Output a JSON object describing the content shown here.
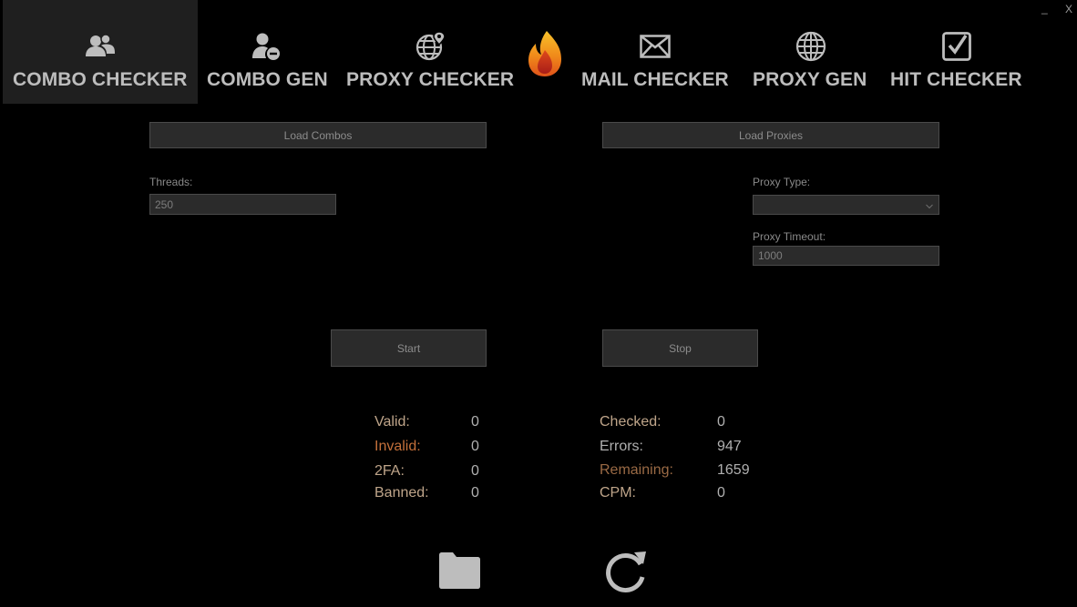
{
  "window": {
    "minimize_label": "_",
    "close_label": "X"
  },
  "nav": {
    "tabs": [
      {
        "label": "COMBO CHECKER",
        "icon": "users-icon",
        "active": true
      },
      {
        "label": "COMBO GEN",
        "icon": "user-minus-icon",
        "active": false
      },
      {
        "label": "PROXY CHECKER",
        "icon": "globe-pin-icon",
        "active": false
      },
      {
        "label": "MAIL CHECKER",
        "icon": "envelope-icon",
        "active": false
      },
      {
        "label": "PROXY GEN",
        "icon": "globe-icon",
        "active": false
      },
      {
        "label": "HIT CHECKER",
        "icon": "checkbox-icon",
        "active": false
      }
    ],
    "logo_icon": "flame-logo-icon"
  },
  "controls": {
    "load_combos_label": "Load Combos",
    "load_proxies_label": "Load Proxies",
    "threads_label": "Threads:",
    "threads_value": "250",
    "proxy_type_label": "Proxy Type:",
    "proxy_type_value": "",
    "proxy_timeout_label": "Proxy Timeout:",
    "proxy_timeout_value": "1000",
    "start_label": "Start",
    "stop_label": "Stop"
  },
  "stats": {
    "valid": {
      "label": "Valid:",
      "value": "0"
    },
    "invalid": {
      "label": "Invalid:",
      "value": "0"
    },
    "twofa": {
      "label": "2FA:",
      "value": "0"
    },
    "banned": {
      "label": "Banned:",
      "value": "0"
    },
    "checked": {
      "label": "Checked:",
      "value": "0"
    },
    "errors": {
      "label": "Errors:",
      "value": "947"
    },
    "remaining": {
      "label": "Remaining:",
      "value": "1659"
    },
    "cpm": {
      "label": "CPM:",
      "value": "0"
    }
  },
  "bottom": {
    "folder_icon": "folder-icon",
    "refresh_icon": "refresh-icon"
  },
  "colors": {
    "background": "#000000",
    "active_tab": "#1f1f1f",
    "control_bg": "#2b2b2b",
    "invalid": "#c4703a",
    "remaining": "#9a6a45"
  }
}
